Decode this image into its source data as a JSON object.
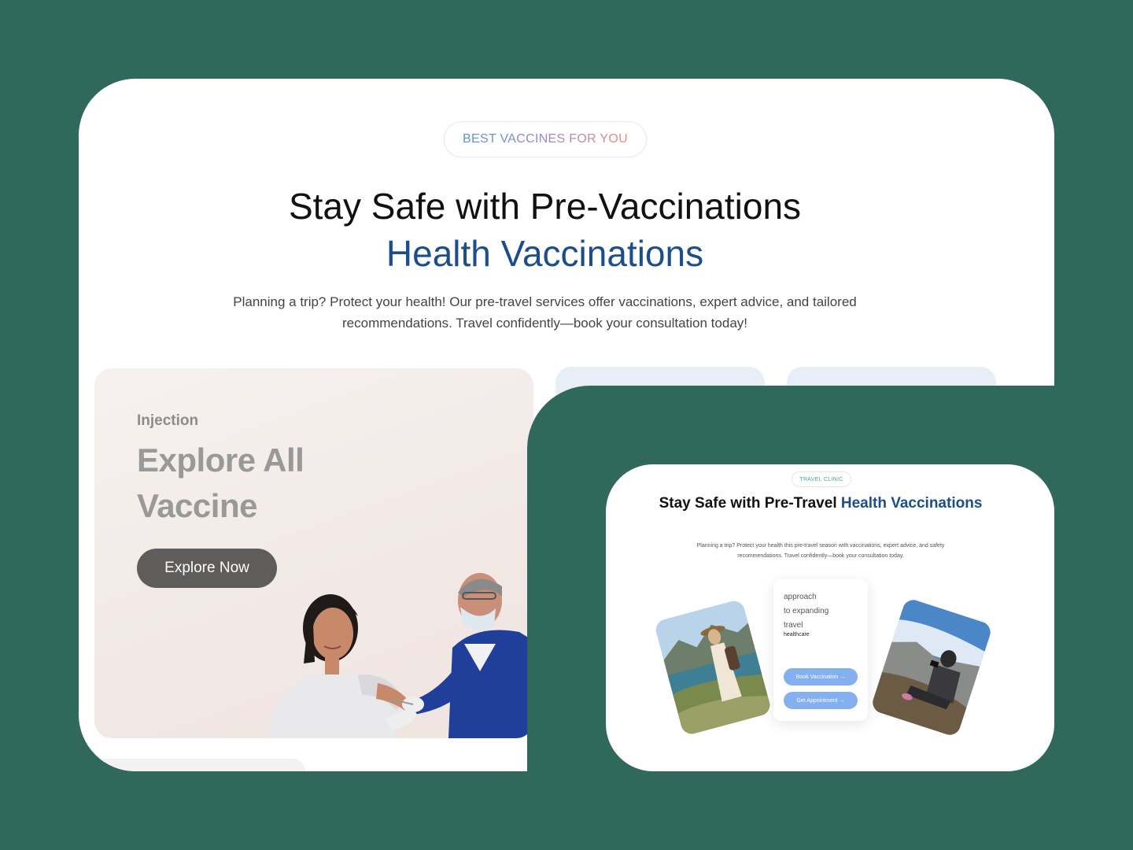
{
  "main": {
    "badge": "BEST VACCINES FOR YOU",
    "title_line1": "Stay Safe with Pre-Vaccinations",
    "title_line2": "Health Vaccinations",
    "description": "Planning a trip? Protect your health! Our pre-travel services offer vaccinations, expert advice, and tailored recommendations. Travel confidently—book your consultation today!",
    "explore_card": {
      "eyebrow": "Injection",
      "title_line1": "Explore All",
      "title_line2": "Vaccine",
      "button": "Explore Now"
    }
  },
  "secondary": {
    "tag": "TRAVEL CLINIC",
    "title_part1": "Stay Safe with Pre-Travel ",
    "title_part2": "Health Vaccinations",
    "description": "Planning a trip? Protect your health this pre-travel season with vaccinations, expert advice, and safety recommendations. Travel confidently—book your consultation today.",
    "center_card": {
      "line1": "approach",
      "line2": "to expanding",
      "line3": "travel",
      "small": "healthcare",
      "button1": "Book Vaccination →",
      "button2": "Get Appointment →"
    }
  },
  "colors": {
    "background": "#30685c",
    "accent_blue": "#1c4e8a",
    "button_blue": "#84b0ef",
    "explore_button": "#5f5d5c"
  }
}
